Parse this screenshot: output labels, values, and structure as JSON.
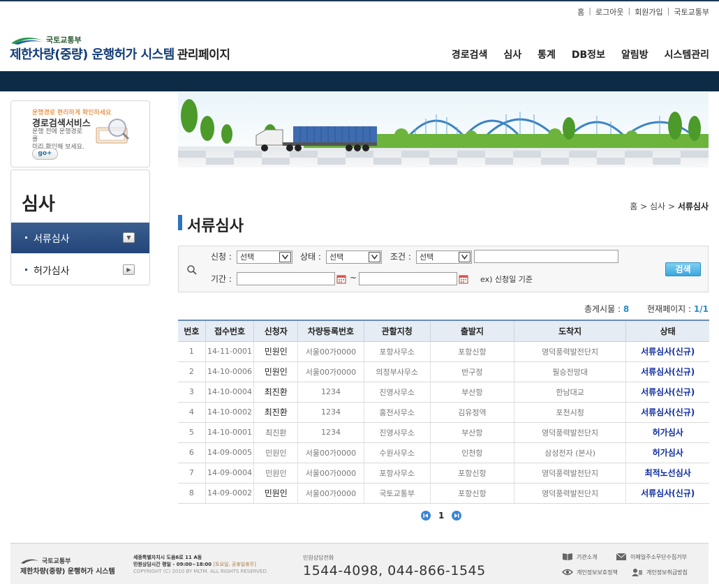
{
  "util_links": [
    "홈",
    "로그아웃",
    "회원가입",
    "국토교통부"
  ],
  "logo": {
    "ministry": "국토교통부",
    "title": "제한차량(중량) 운행허가 시스템",
    "subtitle": "관리페이지"
  },
  "gnb": [
    "경로검색",
    "심사",
    "통계",
    "DB정보",
    "알림방",
    "시스템관리"
  ],
  "promo": {
    "tagline": "운행경로 편리하게 확인하세요",
    "title": "경로검색서비스",
    "desc1": "운행 전에 운행경로를",
    "desc2": "미리 확인해 보세요.",
    "go": "go+"
  },
  "lnb": {
    "title": "심사",
    "items": [
      {
        "label": "서류심사"
      },
      {
        "label": "허가심사"
      }
    ]
  },
  "breadcrumb": {
    "home": "홈",
    "sep": ">",
    "level1": "심사",
    "current": "서류심사"
  },
  "page_title": "서류심사",
  "search": {
    "label_apply": "신청 :",
    "label_status": "상태 :",
    "label_condition": "조건 :",
    "label_period": "기간 :",
    "select_apply": "선택",
    "select_status": "선택",
    "select_condition": "선택",
    "keyword_value": "",
    "date_from": "",
    "date_sep": "~",
    "hint": "ex) 신청일 기준",
    "button": "검색"
  },
  "stats": {
    "total_label": "총게시물 :",
    "total": "8",
    "page_label": "현재페이지 :",
    "page": "1/1"
  },
  "table": {
    "headers": [
      "번호",
      "접수번호",
      "신청자",
      "차량등록번호",
      "관할지청",
      "출발지",
      "도착지",
      "상태"
    ],
    "rows": [
      [
        "1",
        "14-11-0001",
        "민원인",
        "서울00가0000",
        "포항사무소",
        "포항신항",
        "영덕풍력발전단지",
        "서류심사(신규)"
      ],
      [
        "2",
        "14-10-0006",
        "민원인",
        "서울00가0000",
        "의정부사무소",
        "반구정",
        "필승전망대",
        "서류심사(신규)"
      ],
      [
        "3",
        "14-10-0004",
        "최진환",
        "1234",
        "진영사무소",
        "부산항",
        "한남대교",
        "서류심사(신규)"
      ],
      [
        "4",
        "14-10-0002",
        "최진환",
        "1234",
        "홍천사무소",
        "김유정역",
        "포천시청",
        "서류심사(신규)"
      ],
      [
        "5",
        "14-10-0001",
        "최진환",
        "1234",
        "진영사무소",
        "부산항",
        "영덕풍력발전단지",
        "허가심사"
      ],
      [
        "6",
        "14-09-0005",
        "민원인",
        "서울00가0000",
        "수원사무소",
        "인천항",
        "삼성전자 (본사)",
        "허가심사"
      ],
      [
        "7",
        "14-09-0004",
        "민원인",
        "서울00가0000",
        "포항사무소",
        "포항신항",
        "영덕풍력발전단지",
        "최적노선심사"
      ],
      [
        "8",
        "14-09-0002",
        "민원인",
        "서울00가0000",
        "국토교통부",
        "포항신항",
        "영덕풍력발전단지",
        "서류심사(신규)"
      ]
    ]
  },
  "pagination": {
    "current": "1"
  },
  "footer": {
    "ministry": "국토교통부",
    "title": "제한차량(중량) 운행허가 시스템",
    "address": "세종특별자치시 도움6로 11 A동",
    "hours_label": "민원상담시간 평일 - 09:00~18:00",
    "hours_note": "[토요일, 공휴일휴무]",
    "copyright": "COPYRIGHT (C) 2010 BY MLTM. ALL RIGHTS RESERVED.",
    "callcenter_label": "민원상담전화",
    "callcenter": "1544-4098, 044-866-1545",
    "links": [
      "기관소개",
      "이메일주소무단수집거부",
      "개인정보보호정책",
      "개인정보취급방침"
    ]
  },
  "colors": {
    "navbar": "#0d2b44",
    "accent": "#2a72c6",
    "status": "#0e2ca0",
    "button": "#3ca7dc"
  }
}
